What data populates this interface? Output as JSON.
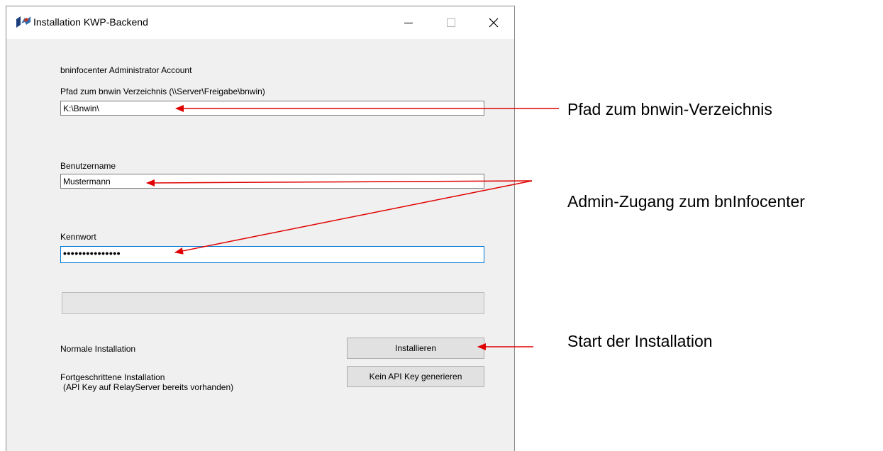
{
  "window": {
    "title": "Installation KWP-Backend",
    "controls": [
      "minimize-icon",
      "maximize-icon",
      "close-icon"
    ]
  },
  "form": {
    "section_label": "bninfocenter Administrator Account",
    "path_label": "Pfad zum bnwin Verzeichnis (\\\\Server\\Freigabe\\bnwin)",
    "path_value": "K:\\Bnwin\\",
    "username_label": "Benutzername",
    "username_value": "Mustermann",
    "password_label": "Kennwort",
    "password_value": "•••••••••••••••",
    "progress": 0,
    "normal_install_label": "Normale Installation",
    "install_button": "Installieren",
    "advanced_install_label": "Fortgeschrittene Installation",
    "advanced_install_note": "(API Key auf RelayServer bereits vorhanden)",
    "no_api_key_button": "Kein API Key generieren"
  },
  "annotations": {
    "path": "Pfad zum bnwin-Verzeichnis",
    "admin": "Admin-Zugang zum bnInfocenter",
    "start": "Start der Installation",
    "arrow_color": "#e00000"
  }
}
